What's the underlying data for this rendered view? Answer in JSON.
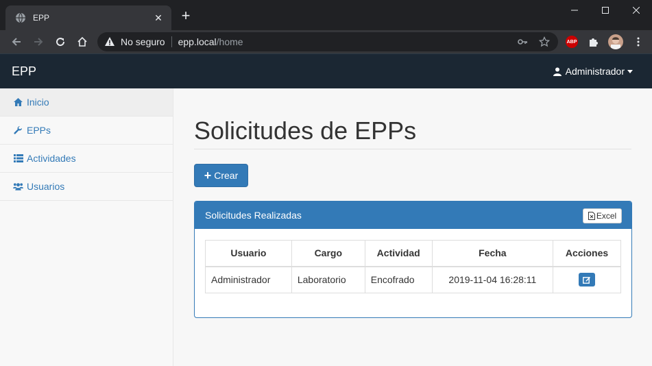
{
  "browser": {
    "tab_title": "EPP",
    "new_tab_symbol": "+",
    "tab_close_symbol": "✕",
    "not_secure_label": "No seguro",
    "url_host": "epp.local",
    "url_path": "/home",
    "abp_label": "ABP"
  },
  "navbar": {
    "brand": "EPP",
    "user_label": "Administrador"
  },
  "sidebar": {
    "items": [
      {
        "label": "Inicio",
        "icon": "home-icon",
        "active": true
      },
      {
        "label": "EPPs",
        "icon": "wrench-icon",
        "active": false
      },
      {
        "label": "Actividades",
        "icon": "list-icon",
        "active": false
      },
      {
        "label": "Usuarios",
        "icon": "users-icon",
        "active": false
      }
    ]
  },
  "main": {
    "title": "Solicitudes de EPPs",
    "create_button": "Crear",
    "panel": {
      "heading": "Solicitudes Realizadas",
      "excel_button": "Excel",
      "columns": [
        "Usuario",
        "Cargo",
        "Actividad",
        "Fecha",
        "Acciones"
      ],
      "rows": [
        {
          "usuario": "Administrador",
          "cargo": "Laboratorio",
          "actividad": "Encofrado",
          "fecha": "2019-11-04 16:28:11"
        }
      ]
    }
  },
  "colors": {
    "primary": "#337ab7",
    "navbar": "#1b2733",
    "chrome": "#202124"
  }
}
